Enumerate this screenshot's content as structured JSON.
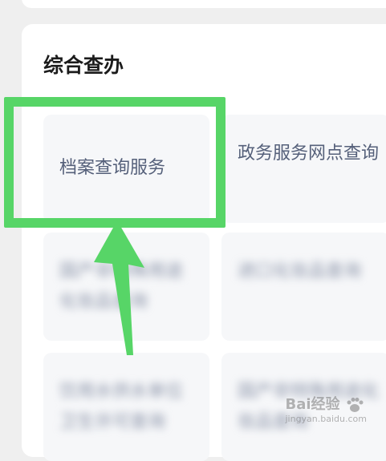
{
  "section": {
    "title": "综合查办"
  },
  "tiles": [
    {
      "label": "档案查询服务"
    },
    {
      "label": "政务服务网点查询"
    },
    {
      "label": "国产非特殊用途化妆品查询"
    },
    {
      "label": "进口化妆品查询"
    },
    {
      "label": "饮用水供水单位卫生许可查询"
    },
    {
      "label": "国产非特殊用途化妆品查询"
    }
  ],
  "watermark": {
    "text": "Bai经验",
    "url": "jingyan.baidu.com"
  },
  "colors": {
    "highlight": "#57d567",
    "tile_background": "#f6f7f9",
    "tile_text": "#55607a"
  }
}
